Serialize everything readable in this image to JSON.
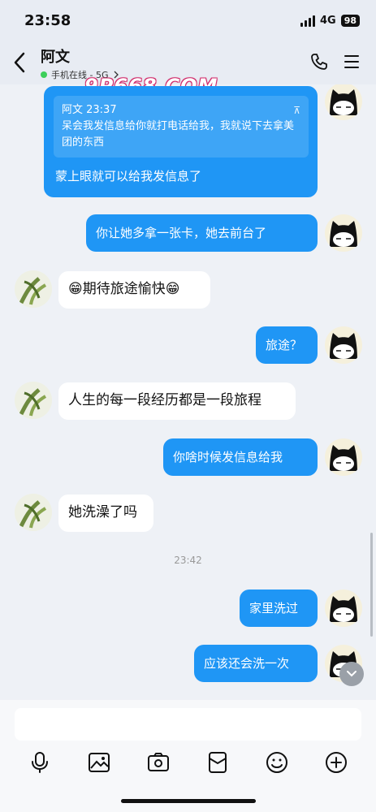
{
  "status_bar": {
    "time": "23:58",
    "network": "4G",
    "battery": "98"
  },
  "header": {
    "name": "阿文",
    "presence": "手机在线 - 5G",
    "watermark": "9P668.COM"
  },
  "messages": {
    "m1": {
      "quote_author_time": "阿文 23:37",
      "quote_text": "呆会我发信息给你就打电话给我，我就说下去拿美团的东西",
      "text": "蒙上眼就可以给我发信息了"
    },
    "m2": {
      "text": "你让她多拿一张卡，她去前台了"
    },
    "m3": {
      "emoji": "😁",
      "text": "期待旅途愉快",
      "emoji2": "😁"
    },
    "m4": {
      "text": "旅途？"
    },
    "m5": {
      "text": "人生的每一段经历都是一段旅程"
    },
    "m6": {
      "text": "你啥时候发信息给我"
    },
    "m7": {
      "text": "她洗澡了吗"
    },
    "timestamp": "23:42",
    "m8": {
      "text": "家里洗过"
    },
    "m9": {
      "text": "应该还会洗一次"
    }
  },
  "input": {
    "placeholder": ""
  },
  "toolbar": [
    "mic-icon",
    "image-icon",
    "camera-icon",
    "red-packet-icon",
    "emoji-icon",
    "plus-icon"
  ]
}
